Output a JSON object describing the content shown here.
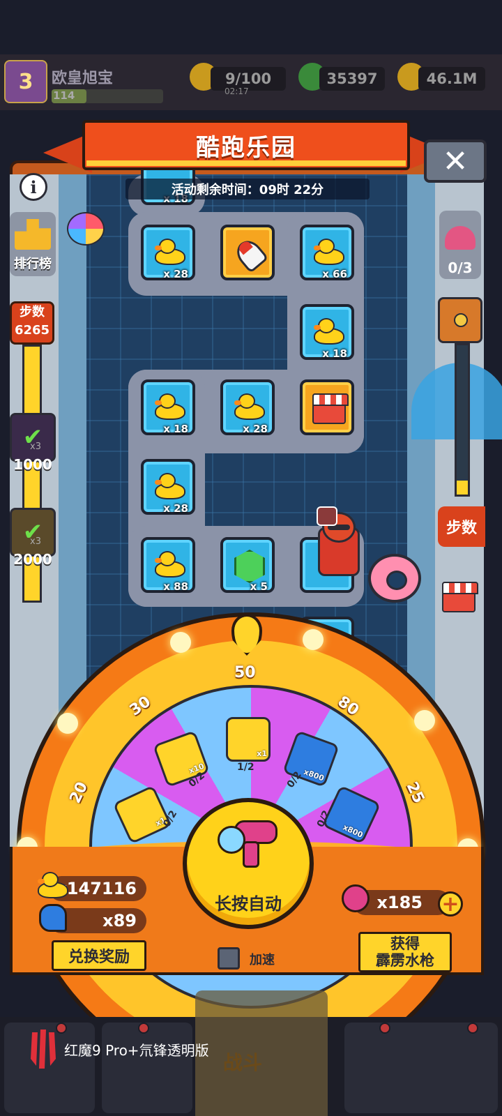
{
  "topbar": {
    "player_name": "欧皇旭宝",
    "player_level": "3",
    "player_xp": "114",
    "energy": "9/100",
    "energy_timer": "02:17",
    "gems": "35397",
    "coins": "46.1M"
  },
  "modal": {
    "title": "酷跑乐园",
    "close_label": "✕",
    "info_label": "i",
    "timer_text": "活动剩余时间：09时 22分",
    "leaderboard_label": "排行榜",
    "steps_label": "步数",
    "steps_value": "6265",
    "milestones": [
      {
        "label": "1000",
        "multiplier": "x3"
      },
      {
        "label": "2000",
        "multiplier": "x3"
      }
    ],
    "right_counter": "0/3",
    "right_steps_label": "步数"
  },
  "board": {
    "tiles": [
      {
        "kind": "duck",
        "count": "x 18"
      },
      {
        "kind": "duck",
        "count": "x 28"
      },
      {
        "kind": "rocket",
        "count": ""
      },
      {
        "kind": "duck",
        "count": "x 66"
      },
      {
        "kind": "duck",
        "count": "x 18"
      },
      {
        "kind": "duck",
        "count": "x 18"
      },
      {
        "kind": "duck",
        "count": "x 28"
      },
      {
        "kind": "shop",
        "count": ""
      },
      {
        "kind": "duck",
        "count": "x 28"
      },
      {
        "kind": "duck",
        "count": "x 88"
      },
      {
        "kind": "gem",
        "count": "x 5"
      }
    ]
  },
  "wheel": {
    "numbers": [
      "50",
      "30",
      "80",
      "20",
      "25"
    ],
    "prizes": [
      {
        "name": "star-ticket-icon",
        "mult": "x1",
        "progress": "0/2"
      },
      {
        "name": "flipper-icon",
        "mult": "x10",
        "progress": "0/2"
      },
      {
        "name": "chest-icon",
        "mult": "x1",
        "progress": "1/2"
      },
      {
        "name": "shell-icon",
        "mult": "x800",
        "progress": "0/2"
      },
      {
        "name": "shell-icon",
        "mult": "x800",
        "progress": "0/2"
      }
    ],
    "spin_label": "长按自动"
  },
  "inventory": {
    "ducks": "x147116",
    "flippers": "x89",
    "water_guns": "x185"
  },
  "actions": {
    "exchange_label": "兑换奖励",
    "get_label_1": "获得",
    "get_label_2": "霹雳水枪",
    "speed_label": "加速"
  },
  "nav": {
    "battle_label": "战斗"
  },
  "watermark": "红魔9 Pro+氘锋透明版",
  "colors": {
    "accent_orange": "#f07a1a",
    "banner_red": "#ef4f1c",
    "wheel_yellow": "#ffc52a",
    "tile_blue": "#30b4e6"
  }
}
